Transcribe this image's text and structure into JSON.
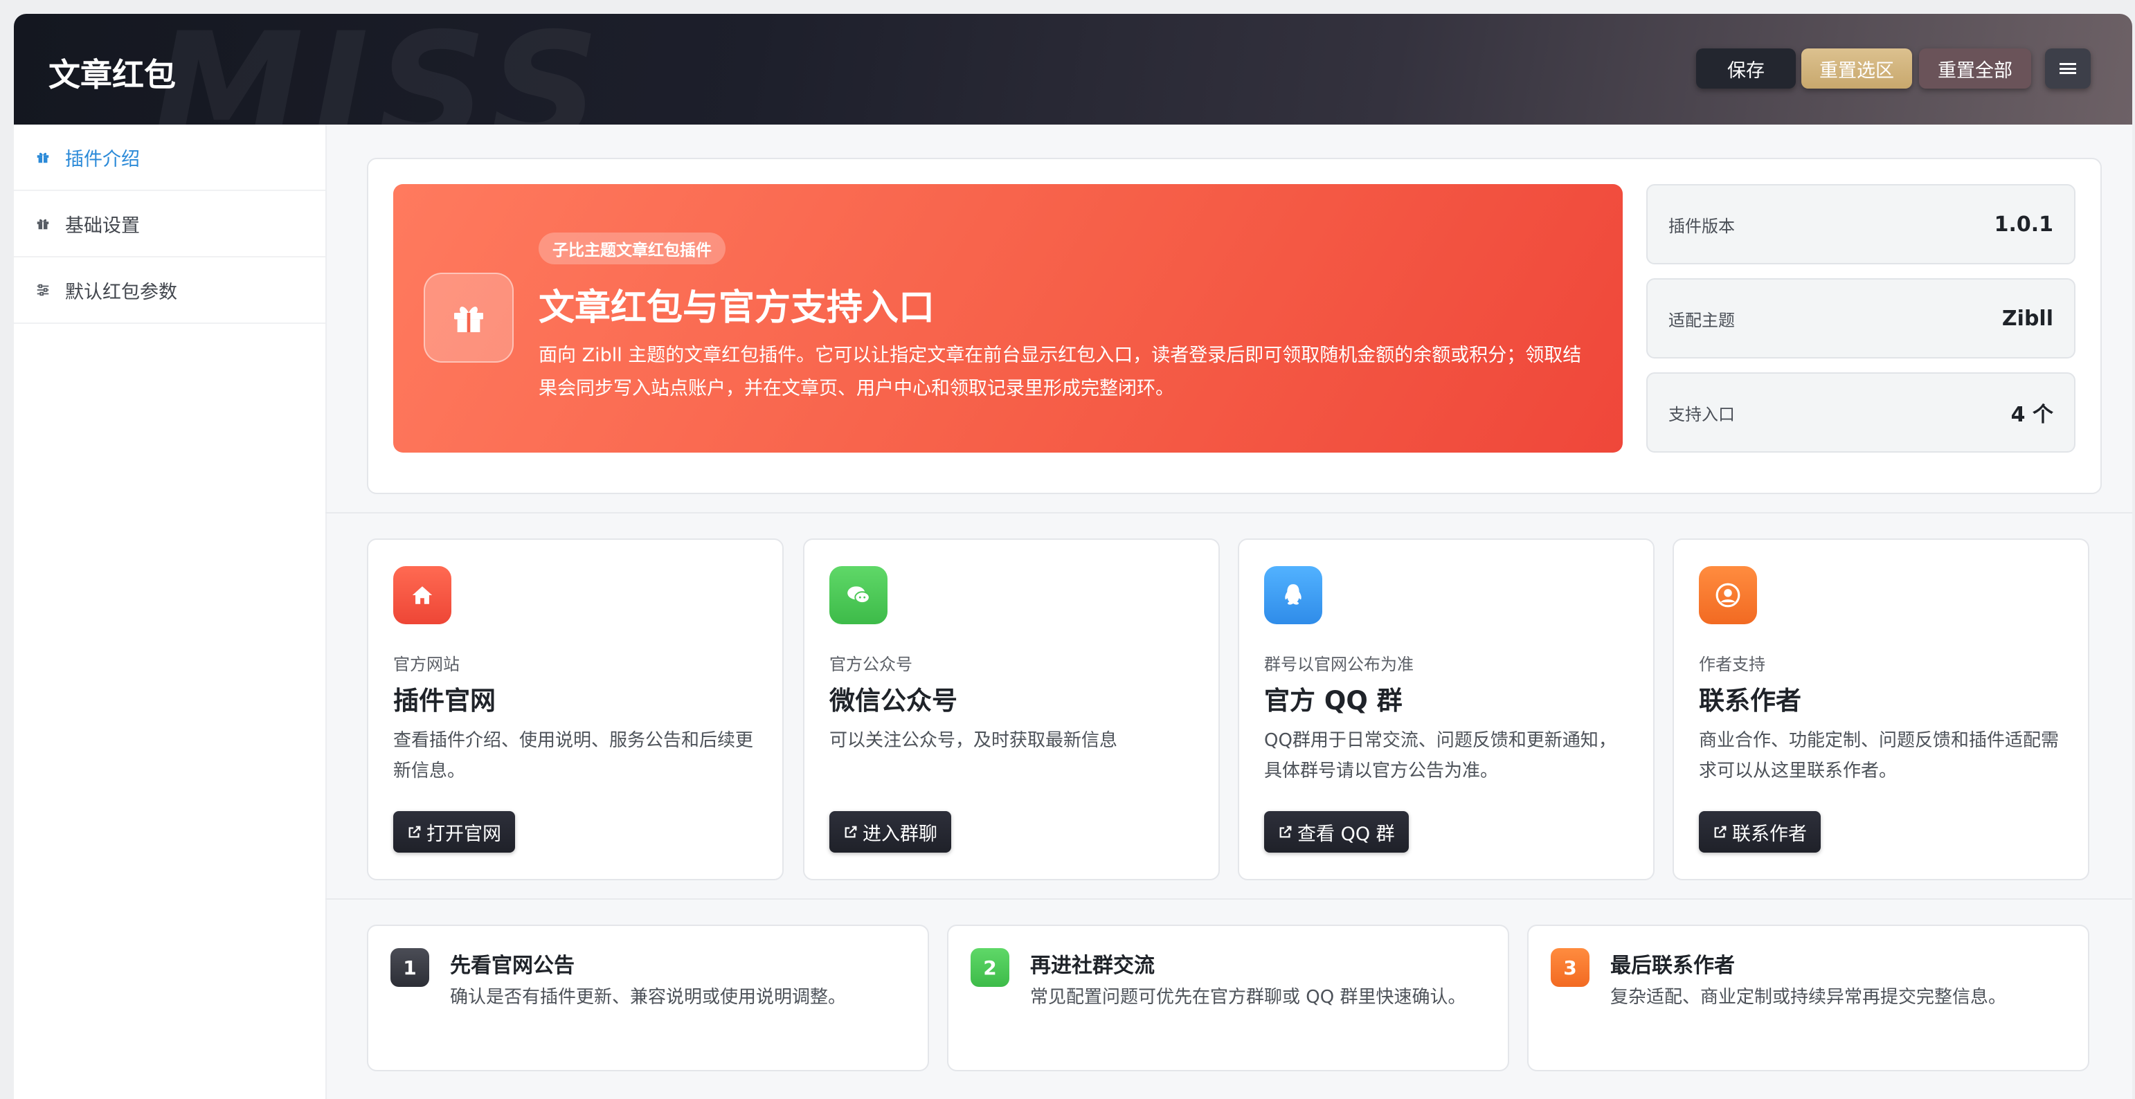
{
  "header": {
    "title": "文章红包",
    "watermark": "MISS",
    "buttons": {
      "save": "保存",
      "reset_selected": "重置选区",
      "reset_all": "重置全部"
    },
    "menu_icon": "menu-icon"
  },
  "sidebar": {
    "items": [
      {
        "label": "插件介绍",
        "icon": "gift-icon",
        "active": true
      },
      {
        "label": "基础设置",
        "icon": "gift-icon",
        "active": false
      },
      {
        "label": "默认红包参数",
        "icon": "sliders-icon",
        "active": false
      }
    ]
  },
  "hero": {
    "badge": "子比主题文章红包插件",
    "title": "文章红包与官方支持入口",
    "description": "面向 Zibll 主题的文章红包插件。它可以让指定文章在前台显示红包入口，读者登录后即可领取随机金额的余额或积分；领取结果会同步写入站点账户，并在文章页、用户中心和领取记录里形成完整闭环。",
    "icon": "gift-icon"
  },
  "stats": [
    {
      "label": "插件版本",
      "value": "1.0.1"
    },
    {
      "label": "适配主题",
      "value": "Zibll"
    },
    {
      "label": "支持入口",
      "value": "4 个"
    }
  ],
  "links": [
    {
      "icon": "home-icon",
      "color": "#f0503f",
      "subtitle": "官方网站",
      "title": "插件官网",
      "description": "查看插件介绍、使用说明、服务公告和后续更新信息。",
      "button": "打开官网"
    },
    {
      "icon": "chat-icon",
      "color": "#4cc856",
      "subtitle": "官方公众号",
      "title": "微信公众号",
      "description": "可以关注公众号，及时获取最新信息",
      "button": "进入群聊"
    },
    {
      "icon": "qq-icon",
      "color": "#3c9cf2",
      "subtitle": "群号以官网公布为准",
      "title": "官方 QQ 群",
      "description": "QQ群用于日常交流、问题反馈和更新通知，具体群号请以官方公告为准。",
      "button": "查看 QQ 群"
    },
    {
      "icon": "user-icon",
      "color": "#f7782f",
      "subtitle": "作者支持",
      "title": "联系作者",
      "description": "商业合作、功能定制、问题反馈和插件适配需求可以从这里联系作者。",
      "button": "联系作者"
    }
  ],
  "steps": [
    {
      "number": "1",
      "color": "#3a3c44",
      "title": "先看官网公告",
      "description": "确认是否有插件更新、兼容说明或使用说明调整。"
    },
    {
      "number": "2",
      "color": "#4cc856",
      "title": "再进社群交流",
      "description": "常见配置问题可优先在官方群聊或 QQ 群里快速确认。"
    },
    {
      "number": "3",
      "color": "#f7782f",
      "title": "最后联系作者",
      "description": "复杂适配、商业定制或持续异常再提交完整信息。"
    }
  ]
}
